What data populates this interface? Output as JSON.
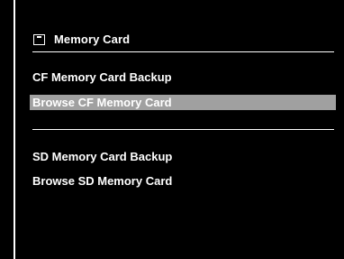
{
  "header": {
    "title": "Memory Card",
    "icon": "memory-card-icon"
  },
  "menu": {
    "items": [
      {
        "label": "CF Memory Card Backup",
        "selected": false
      },
      {
        "label": "Browse CF Memory Card",
        "selected": true
      },
      {
        "label": "SD Memory Card Backup",
        "selected": false
      },
      {
        "label": "Browse SD Memory Card",
        "selected": false
      }
    ]
  },
  "colors": {
    "background": "#000000",
    "text": "#ffffff",
    "selection": "#a0a0a0"
  }
}
